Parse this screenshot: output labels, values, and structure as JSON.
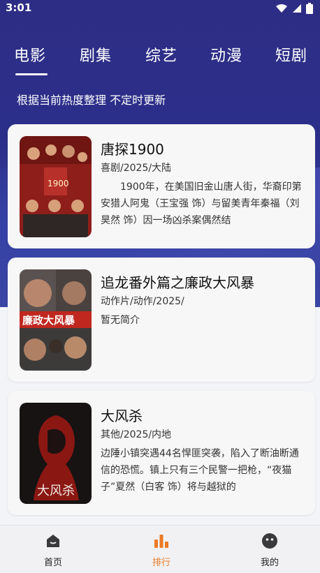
{
  "status_bar": {
    "time": "3:01"
  },
  "tabs": [
    "电影",
    "剧集",
    "综艺",
    "动漫",
    "短剧"
  ],
  "subtitle": "根据当前热度整理 不定时更新",
  "movies": [
    {
      "title": "唐探1900",
      "meta": "喜剧/2025/大陆",
      "description": "1900年，在美国旧金山唐人街，华裔印第安猎人阿鬼（王宝强 饰）与留美青年秦福（刘昊然 饰）因一场凶杀案偶然结"
    },
    {
      "title": "追龙番外篇之廉政大风暴",
      "meta": "动作片/动作/2025/",
      "description": "暂无简介"
    },
    {
      "title": "大风杀",
      "meta": "其他/2025/内地",
      "description": "边陲小镇突遇44名悍匪突袭，陷入了断油断通信的恐慌。镇上只有三个民警一把枪，“夜猫子”夏然（白客 饰）将与越狱的"
    }
  ],
  "bottom_nav": [
    {
      "label": "首页",
      "icon": "home-icon"
    },
    {
      "label": "排行",
      "icon": "ranking-bar-icon"
    },
    {
      "label": "我的",
      "icon": "profile-face-icon"
    }
  ],
  "colors": {
    "hero_bg": "#2e2d85",
    "active": "#ec7a24"
  }
}
